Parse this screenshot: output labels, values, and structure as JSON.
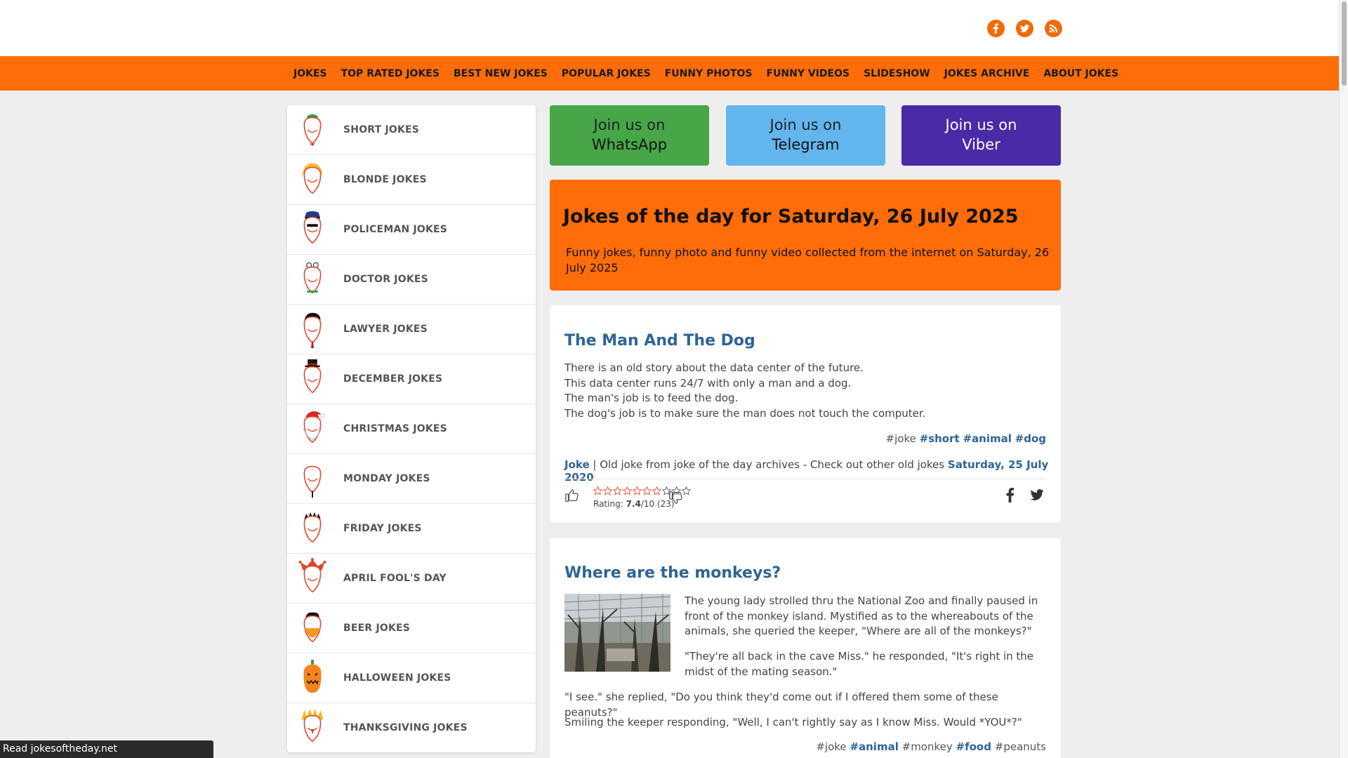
{
  "colors": {
    "brand_orange": "#ff6d0a",
    "link_blue": "#2e6496",
    "whatsapp": "#46a648",
    "telegram": "#63b5ee",
    "viber": "#4a2aa6"
  },
  "header": {
    "social": [
      {
        "name": "facebook",
        "icon": "facebook-icon"
      },
      {
        "name": "twitter",
        "icon": "twitter-icon"
      },
      {
        "name": "rss",
        "icon": "rss-icon"
      }
    ]
  },
  "nav": {
    "items": [
      "JOKES",
      "TOP RATED JOKES",
      "BEST NEW JOKES",
      "POPULAR JOKES",
      "FUNNY PHOTOS",
      "FUNNY VIDEOS",
      "SLIDESHOW",
      "JOKES ARCHIVE",
      "ABOUT JOKES"
    ]
  },
  "sidebar": {
    "items": [
      {
        "label": "SHORT JOKES",
        "icon": "short-face-icon"
      },
      {
        "label": "BLONDE JOKES",
        "icon": "blonde-face-icon"
      },
      {
        "label": "POLICEMAN JOKES",
        "icon": "policeman-face-icon"
      },
      {
        "label": "DOCTOR JOKES",
        "icon": "doctor-face-icon"
      },
      {
        "label": "LAWYER JOKES",
        "icon": "lawyer-face-icon"
      },
      {
        "label": "DECEMBER JOKES",
        "icon": "snowman-face-icon"
      },
      {
        "label": "CHRISTMAS JOKES",
        "icon": "santa-face-icon"
      },
      {
        "label": "MONDAY JOKES",
        "icon": "monday-face-icon"
      },
      {
        "label": "FRIDAY JOKES",
        "icon": "friday-face-icon"
      },
      {
        "label": "APRIL FOOL'S DAY",
        "icon": "jester-face-icon"
      },
      {
        "label": "BEER JOKES",
        "icon": "beer-face-icon"
      },
      {
        "label": "HALLOWEEN JOKES",
        "icon": "pumpkin-face-icon"
      },
      {
        "label": "THANKSGIVING JOKES",
        "icon": "turkey-face-icon"
      }
    ]
  },
  "join": {
    "prefix": "Join us on",
    "whatsapp": "WhatsApp",
    "telegram": "Telegram",
    "viber": "Viber"
  },
  "hero": {
    "title": "Jokes of the day for Saturday, 26 July 2025",
    "subtitle": "Funny jokes, funny photo and funny video collected from the internet on Saturday, 26 July 2025"
  },
  "joke1": {
    "title": "The Man And The Dog",
    "lines": [
      "There is an old story about the data center of the future.",
      "This data center runs 24/7 with only a man and a dog.",
      "The man's job is to feed the dog.",
      "The dog's job is to make sure the man does not touch the computer."
    ],
    "tag_plain": "#joke",
    "tags_bold": [
      "#short",
      "#animal",
      "#dog"
    ],
    "meta_type": "Joke",
    "meta_text": "| Old joke from joke of the day archives - Check out other old jokes",
    "meta_date": "Saturday, 25 July 2020",
    "rating_label": "Rating:",
    "rating_value": "7.4",
    "rating_rest": "/10 (23)",
    "rating_fraction": 0.74
  },
  "joke2": {
    "title": "Where are the monkeys?",
    "image_alt": "monkey-enclosure-photo",
    "p1": "The young lady strolled thru the National Zoo and finally paused in front of the monkey island. Mystified as to the whereabouts of the animals, she queried the keeper, \"Where are all of the monkeys?\"",
    "p2": "\"They're all back in the cave Miss.\" he responded, \"It's right in the midst of the mating season.\"",
    "p3": "\"I see.\" she replied, \"Do you think they'd come out if I offered them some of these peanuts?\"",
    "p4": "Smiling the keeper responding, \"Well, I can't rightly say as I know Miss. Would *YOU*?\"",
    "tags": [
      {
        "text": "#joke",
        "bold": false
      },
      {
        "text": "#animal",
        "bold": true
      },
      {
        "text": "#monkey",
        "bold": false
      },
      {
        "text": "#food",
        "bold": true
      },
      {
        "text": "#peanuts",
        "bold": false
      }
    ]
  },
  "status": {
    "text": "Read jokesoftheday.net"
  }
}
